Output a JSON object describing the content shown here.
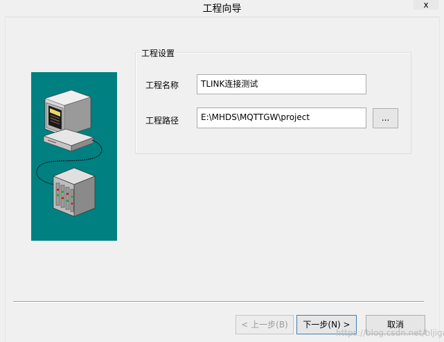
{
  "window": {
    "title": "工程向导",
    "close_label": "x"
  },
  "group": {
    "legend": "工程设置"
  },
  "fields": {
    "name_label": "工程名称",
    "name_value": "TLINK连接测试",
    "path_label": "工程路径",
    "path_value": "E:\\MHDS\\MQTTGW\\project",
    "browse_label": "..."
  },
  "footer": {
    "back_label": "< 上一步(B)",
    "next_label": "下一步(N) >",
    "cancel_label": "取消"
  },
  "watermark": "https://blog.csdn.net/bljigang",
  "colors": {
    "wizard_art_bg": "#008080",
    "window_bg": "#f0f0f0"
  }
}
